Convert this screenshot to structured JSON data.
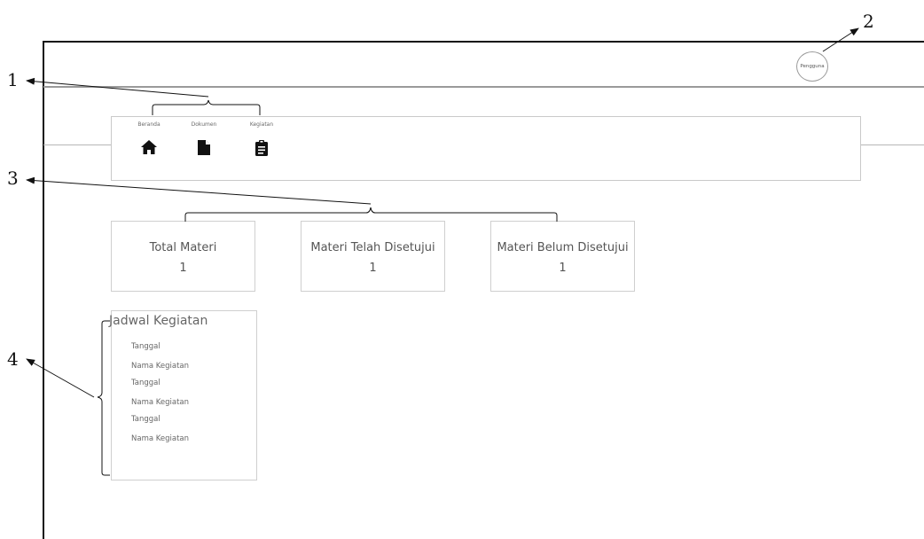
{
  "callouts": [
    "1",
    "2",
    "3",
    "4"
  ],
  "header": {
    "avatar_label": "Pengguna"
  },
  "nav": {
    "items": [
      {
        "label": "Beranda",
        "icon": "home-icon"
      },
      {
        "label": "Dokumen",
        "icon": "document-icon"
      },
      {
        "label": "Kegiatan",
        "icon": "clipboard-icon"
      }
    ]
  },
  "stats": [
    {
      "title": "Total Materi",
      "value": "1"
    },
    {
      "title": "Materi Telah Disetujui",
      "value": "1"
    },
    {
      "title": "Materi Belum Disetujui",
      "value": "1"
    }
  ],
  "schedule": {
    "title": "Jadwal Kegiatan",
    "entries": [
      {
        "date": "Tanggal",
        "name": "Nama Kegiatan"
      },
      {
        "date": "Tanggal",
        "name": "Nama Kegiatan"
      },
      {
        "date": "Tanggal",
        "name": "Nama Kegiatan"
      }
    ]
  },
  "colors": {
    "line": "#111111",
    "border": "#cfcfcf",
    "text": "#555555"
  }
}
